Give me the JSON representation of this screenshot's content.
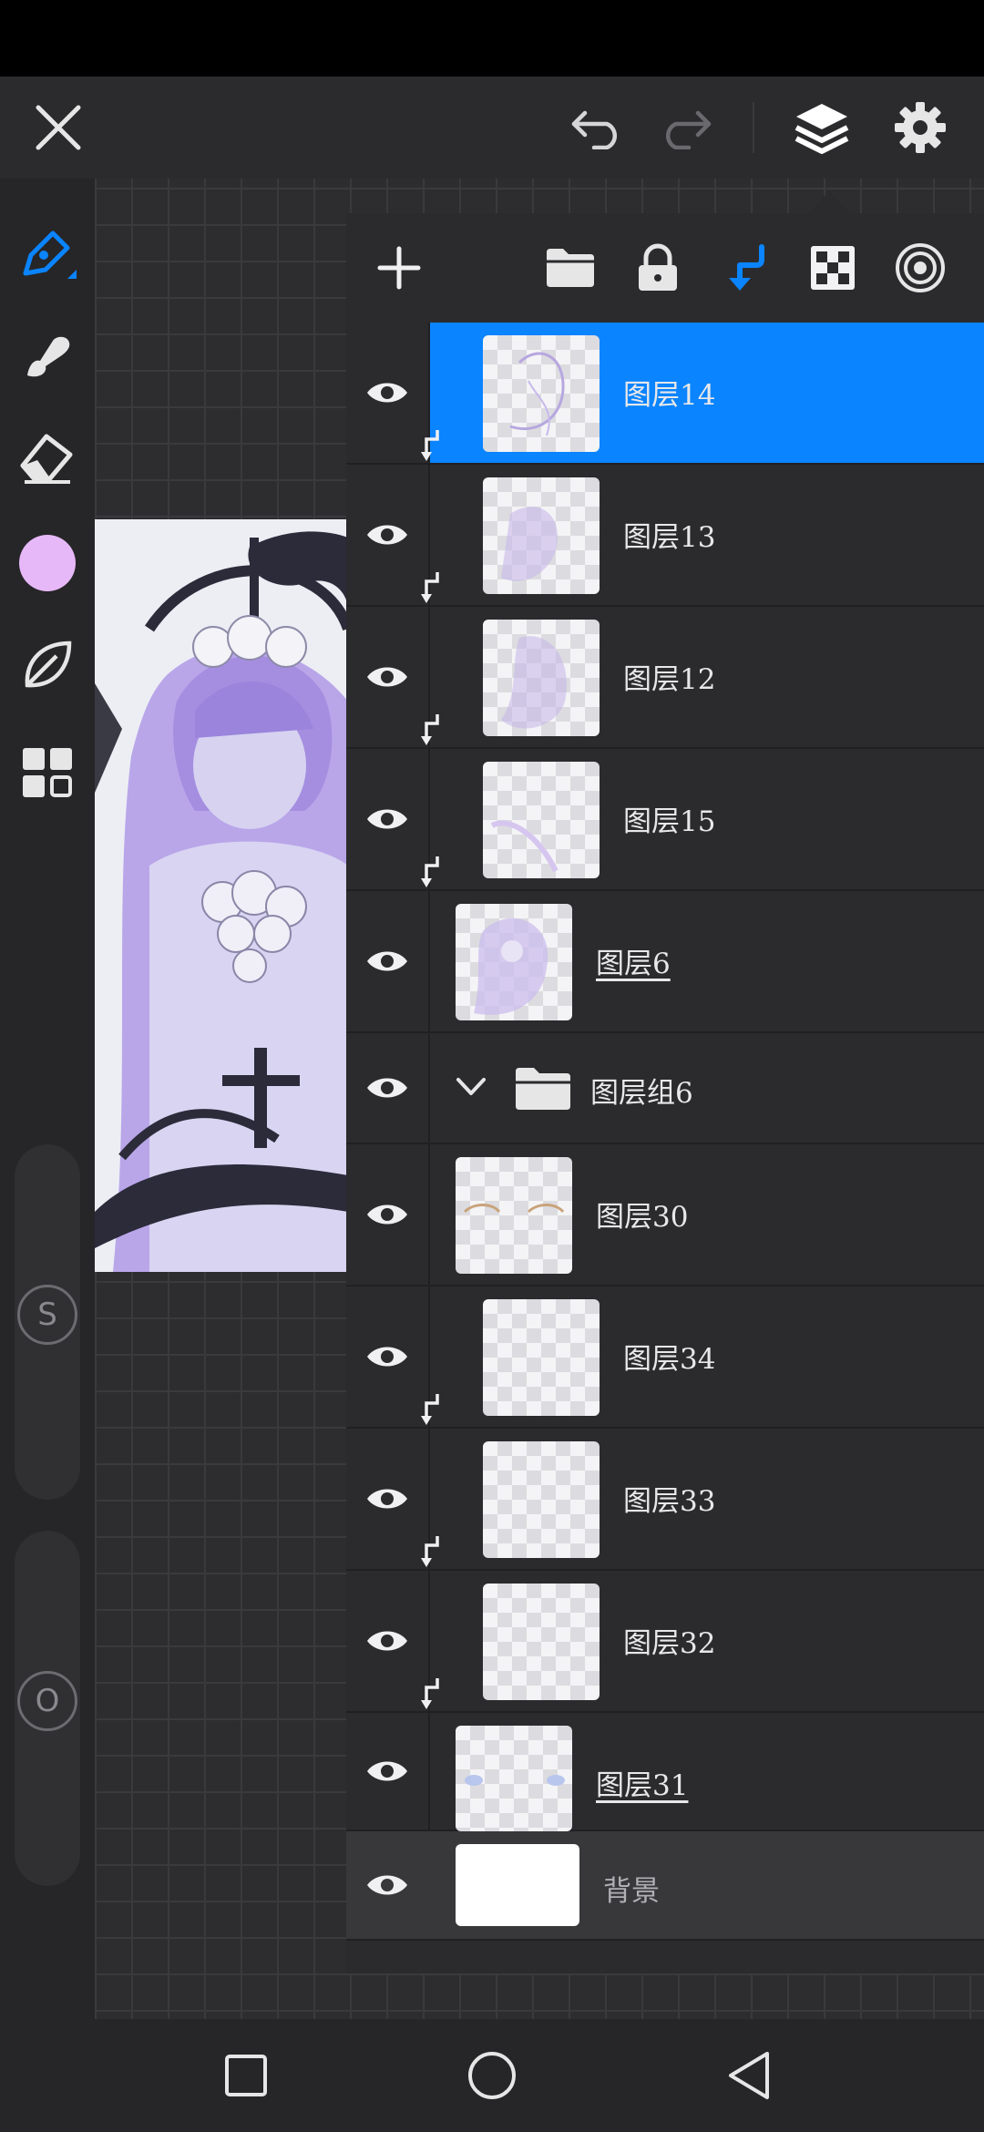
{
  "toolbar": {
    "close": "close-icon",
    "undo": "undo-icon",
    "redo": "redo-icon",
    "layers": "layers-icon",
    "settings": "gear-icon"
  },
  "tools": {
    "pen": "pen-icon",
    "smudge": "smudge-icon",
    "eraser": "eraser-icon",
    "color": "#e7b8f8",
    "leaf": "leaf-icon",
    "grid": "grid-icon",
    "size_slider_label": "S",
    "opacity_slider_label": "O"
  },
  "layer_panel": {
    "tools": [
      "add-icon",
      "folder-icon",
      "lock-icon",
      "clip-icon",
      "alpha-lock-icon",
      "blend-icon"
    ],
    "layers": [
      {
        "name": "图层14",
        "selected": true,
        "clipped": true
      },
      {
        "name": "图层13",
        "selected": false,
        "clipped": true
      },
      {
        "name": "图层12",
        "selected": false,
        "clipped": true
      },
      {
        "name": "图层15",
        "selected": false,
        "clipped": true
      },
      {
        "name": "图层6",
        "selected": false,
        "clipped": false
      },
      {
        "name": "图层组6",
        "group": true
      },
      {
        "name": "图层30",
        "selected": false,
        "clipped": false
      },
      {
        "name": "图层34",
        "selected": false,
        "clipped": true
      },
      {
        "name": "图层33",
        "selected": false,
        "clipped": true
      },
      {
        "name": "图层32",
        "selected": false,
        "clipped": true
      },
      {
        "name": "图层31",
        "selected": false,
        "clipped": false
      },
      {
        "name": "背景",
        "selected": false,
        "clipped": false
      }
    ]
  },
  "navbar": [
    "recents-icon",
    "home-icon",
    "back-icon"
  ]
}
